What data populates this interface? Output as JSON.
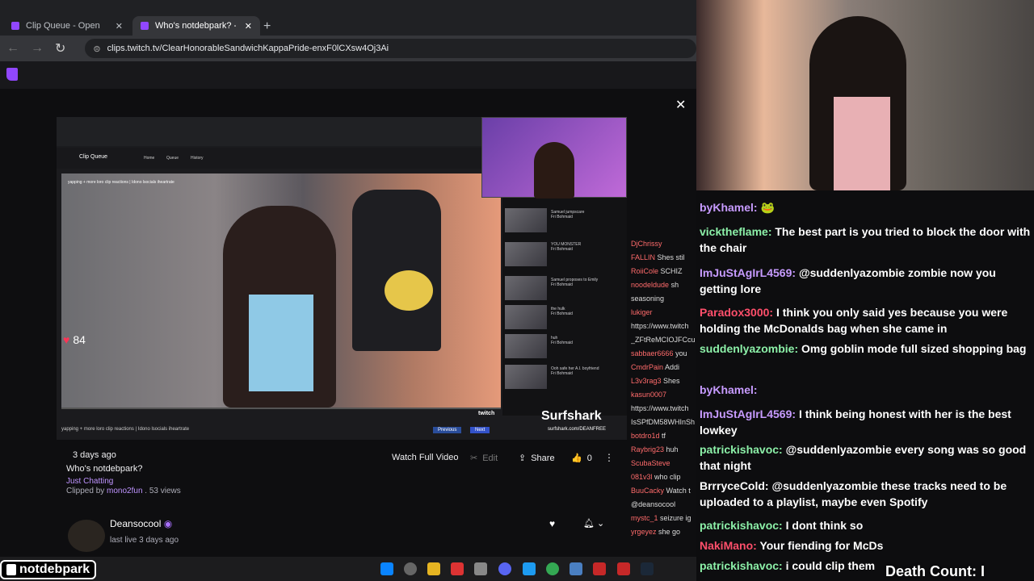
{
  "browser": {
    "tabs": [
      {
        "label": "Clip Queue - Open"
      },
      {
        "label": "Who's notdebpark? - Twitch"
      }
    ],
    "url": "clips.twitch.tv/ClearHonorableSandwichKappaPride-enxF0lCXsw4Oj3Ai"
  },
  "player": {
    "inner_app_title": "Clip Queue",
    "inner_tabs": [
      "Home",
      "Queue",
      "History"
    ],
    "inner_clip_title": "yapping + more loro clip reactions | Idono lsocials iheartrate",
    "heart_rate": "84",
    "caption": "yapping + more loro clip reactions | Idono lsocials iheartrate",
    "prev_label": "Previous",
    "next_label": "Next",
    "sponsor": "Surfshark",
    "sponsor_sub": "surfshark.com/DEANFREE",
    "brand": "twitch",
    "side_items": [
      {
        "title": "Samuel jumpscare",
        "sub": "Fri Bohmaid"
      },
      {
        "title": "YOU MONSTER",
        "sub": "Fri Bohmaid"
      },
      {
        "title": "Samuel proposes to Emily",
        "sub": "Fri Bohmaid"
      },
      {
        "title": "the hulk",
        "sub": "Fri Bohmaid"
      },
      {
        "title": "huh",
        "sub": "Fri Bohmaid"
      },
      {
        "title": "Ooh safe her A.I. boyfriend",
        "sub": "Fri Bohmaid"
      }
    ]
  },
  "clip": {
    "age": "3 days ago",
    "title": "Who's notdebpark?",
    "category": "Just Chatting",
    "clipped_by_prefix": "Clipped by ",
    "clipped_by": "mono2fun",
    "views": " . 53 views",
    "watch_full": "Watch Full Video",
    "edit": "Edit",
    "share": "Share",
    "likes": "0",
    "channel": "Deansocool",
    "last_live": "last live 3 days ago"
  },
  "side_chat": [
    {
      "user": "DjChrissy",
      "text": ""
    },
    {
      "user": "FALLIN",
      "text": "Shes stil"
    },
    {
      "user": "RoiiCole",
      "text": "SCHIZ"
    },
    {
      "user": "noodeldude",
      "text": "sh"
    },
    {
      "user": "",
      "text": "seasoning"
    },
    {
      "user": "lukiger",
      "text": ""
    },
    {
      "user": "",
      "text": "https://www.twitch"
    },
    {
      "user": "",
      "text": "_ZFtReMCIOJFCcu"
    },
    {
      "user": "sabbaer6666",
      "text": "you"
    },
    {
      "user": "CmdrPain",
      "text": "Addi"
    },
    {
      "user": "L3v3rag3",
      "text": "Shes"
    },
    {
      "user": "kasun0007",
      "text": ""
    },
    {
      "user": "",
      "text": "https://www.twitch"
    },
    {
      "user": "",
      "text": "IsSPfDM58WHInSh"
    },
    {
      "user": "botdro1d",
      "text": "tf"
    },
    {
      "user": "Raybrig23",
      "text": "huh"
    },
    {
      "user": "ScubaSteve",
      "text": ""
    },
    {
      "user": "081v3l",
      "text": "who clip"
    },
    {
      "user": "BuuCacky",
      "text": "Watch t"
    },
    {
      "user": "",
      "text": "@deansocool"
    },
    {
      "user": "mystc_1",
      "text": "seizure ig"
    },
    {
      "user": "yrgeyez",
      "text": "she go"
    }
  ],
  "chat": [
    {
      "user": "byKhamel:",
      "text": "🐸",
      "color": "#c79bff"
    },
    {
      "user": "vicktheflame:",
      "text": "The best part is you tried to block the door with the chair",
      "color": "#8cf0a8"
    },
    {
      "user": "ImJuStAgIrL4569:",
      "text": "@suddenlyazombie zombie now you getting lore",
      "color": "#c79bff"
    },
    {
      "user": "Paradox3000:",
      "text": "I think you only said yes because you were holding the McDonalds bag when she came in",
      "color": "#ff4f6b"
    },
    {
      "user": "suddenlyazombie:",
      "text": "Omg goblin mode full sized shopping bag",
      "color": "#8cf0a8"
    },
    {
      "user": "byKhamel:",
      "text": "",
      "color": "#c79bff"
    },
    {
      "user": "ImJuStAgIrL4569:",
      "text": "I think being honest with her is the best lowkey",
      "color": "#c79bff"
    },
    {
      "user": "patrickishavoc:",
      "text": "@suddenlyazombie every song was so good that night",
      "color": "#8cf0a8"
    },
    {
      "user": "BrrryceCold:",
      "text": "@suddenlyazombie these tracks need to be uploaded to a playlist, maybe even Spotify",
      "color": "#ffffff"
    },
    {
      "user": "patrickishavoc:",
      "text": "I dont think so",
      "color": "#8cf0a8"
    },
    {
      "user": "NakiMano:",
      "text": "Your fiending for McDs",
      "color": "#ff4f6b"
    },
    {
      "user": "patrickishavoc:",
      "text": "i could clip them",
      "color": "#8cf0a8"
    }
  ],
  "overlay": {
    "streamer_name": "notdebpark",
    "death_count": "Death Count: I"
  },
  "colors": {
    "accent": "#9147ff",
    "twitch": "#a970ff",
    "link": "#bf94ff"
  }
}
